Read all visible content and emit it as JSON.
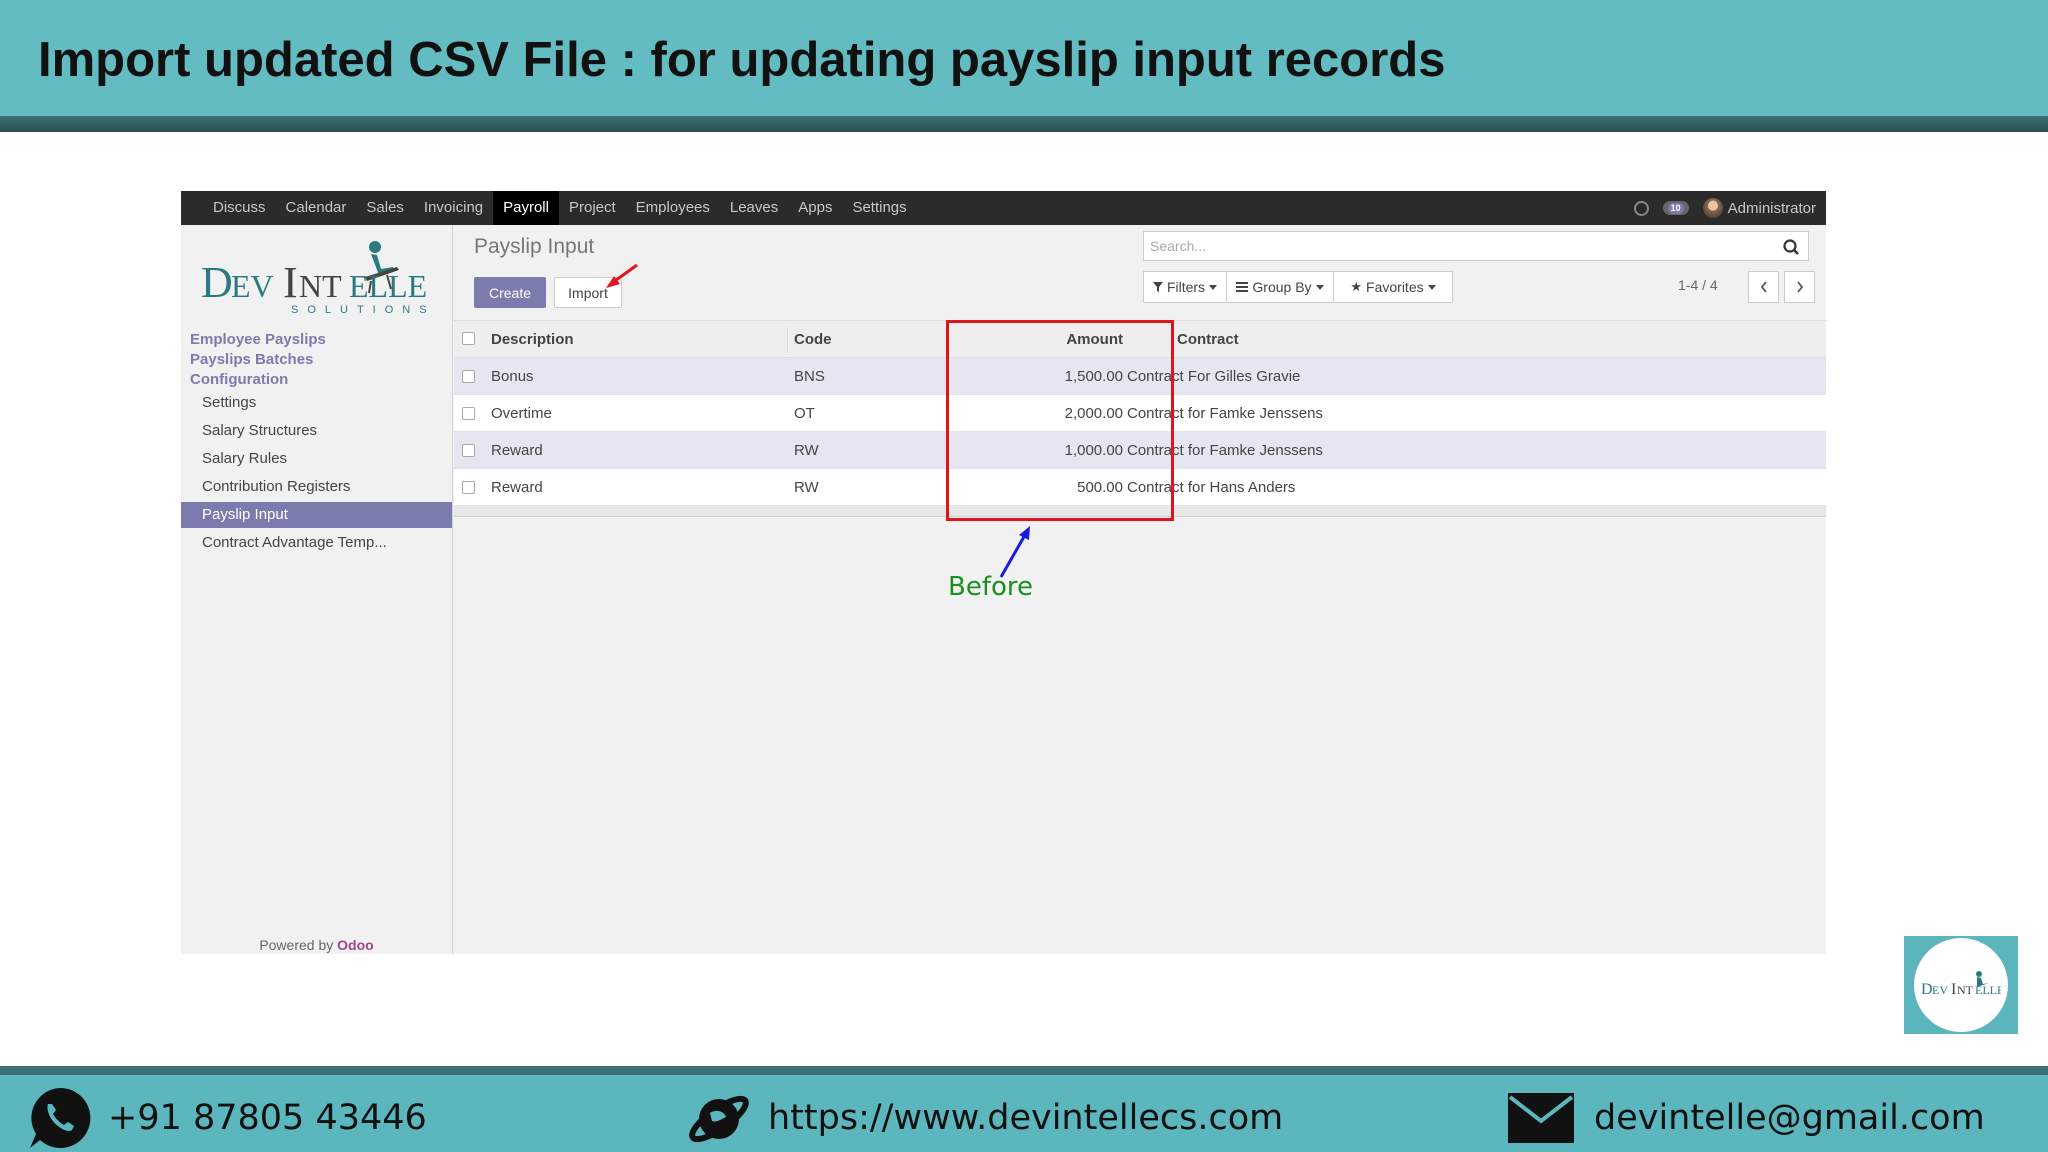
{
  "slide": {
    "title": "Import updated CSV File : for updating payslip input records"
  },
  "topnav": {
    "items": [
      "Discuss",
      "Calendar",
      "Sales",
      "Invoicing",
      "Payroll",
      "Project",
      "Employees",
      "Leaves",
      "Apps",
      "Settings"
    ],
    "active_item": "Payroll",
    "notification_count": "10",
    "user_name": "Administrator"
  },
  "sidebar": {
    "logo_text": "DevIntelle",
    "logo_subtext": "SOLUTIONS",
    "sections": [
      "Employee Payslips",
      "Payslips Batches",
      "Configuration"
    ],
    "items": [
      "Settings",
      "Salary Structures",
      "Salary Rules",
      "Contribution Registers",
      "Payslip Input",
      "Contract Advantage Temp..."
    ],
    "active_item": "Payslip Input",
    "powered_prefix": "Powered by",
    "powered_brand": "Odoo"
  },
  "control_panel": {
    "breadcrumb": "Payslip Input",
    "create_label": "Create",
    "import_label": "Import",
    "search_placeholder": "Search...",
    "filters_label": "Filters",
    "groupby_label": "Group By",
    "favorites_label": "Favorites",
    "pager": "1-4 / 4"
  },
  "table": {
    "columns": [
      "Description",
      "Code",
      "Amount",
      "Contract"
    ],
    "rows": [
      {
        "description": "Bonus",
        "code": "BNS",
        "amount": "1,500.00",
        "contract": "Contract For Gilles Gravie"
      },
      {
        "description": "Overtime",
        "code": "OT",
        "amount": "2,000.00",
        "contract": "Contract for Famke Jenssens"
      },
      {
        "description": "Reward",
        "code": "RW",
        "amount": "1,000.00",
        "contract": "Contract for Famke Jenssens"
      },
      {
        "description": "Reward",
        "code": "RW",
        "amount": "500.00",
        "contract": "Contract for Hans Anders"
      }
    ]
  },
  "annotation": {
    "before_label": "Before"
  },
  "footer": {
    "phone": "+91 87805 43446",
    "website": "https://www.devintellecs.com",
    "email": "devintelle@gmail.com"
  },
  "colors": {
    "header_teal": "#63bcc1",
    "odoo_purple": "#7c7bad",
    "highlight_red": "#e0141c",
    "annotation_green": "#1a8f1f",
    "annotation_blue": "#1a1ae0"
  }
}
